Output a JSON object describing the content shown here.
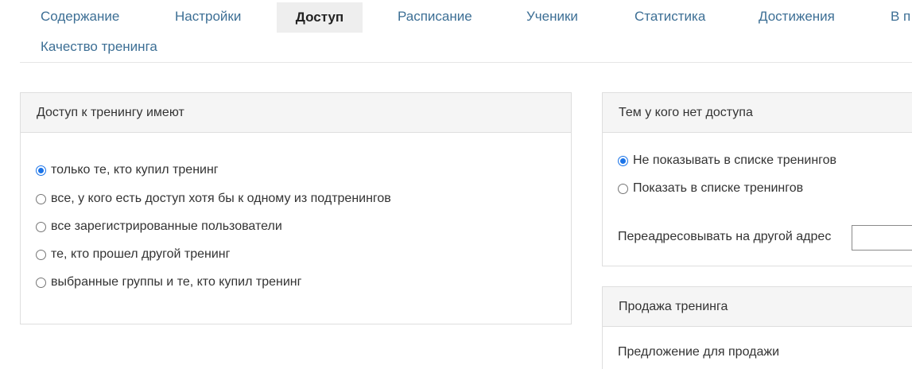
{
  "tabs": [
    {
      "label": "Содержание",
      "active": false
    },
    {
      "label": "Настройки",
      "active": false
    },
    {
      "label": "Доступ",
      "active": true
    },
    {
      "label": "Расписание",
      "active": false
    },
    {
      "label": "Ученики",
      "active": false
    },
    {
      "label": "Статистика",
      "active": false
    },
    {
      "label": "Достижения",
      "active": false
    },
    {
      "label": "В п",
      "active": false
    },
    {
      "label": "Качество тренинга",
      "active": false
    }
  ],
  "access_panel": {
    "title": "Доступ к тренингу имеют",
    "options": [
      {
        "label": "только те, кто купил тренинг",
        "checked": true
      },
      {
        "label": "все, у кого есть доступ хотя бы к одному из подтренингов",
        "checked": false
      },
      {
        "label": "все зарегистрированные пользователи",
        "checked": false
      },
      {
        "label": "те, кто прошел другой тренинг",
        "checked": false
      },
      {
        "label": "выбранные группы и те, кто купил тренинг",
        "checked": false
      }
    ]
  },
  "no_access_panel": {
    "title": "Тем у кого нет доступа",
    "options": [
      {
        "label": "Не показывать в списке тренингов",
        "checked": true
      },
      {
        "label": "Показать в списке тренингов",
        "checked": false
      }
    ],
    "redirect_label": "Переадресовывать на другой адрес",
    "redirect_value": ""
  },
  "sale_panel": {
    "title": "Продажа тренинга",
    "offer_label": "Предложение для продажи"
  },
  "colors": {
    "tab_link": "#3d6f95",
    "tab_active_bg": "#eeeeee",
    "panel_header_bg": "#f5f5f5",
    "panel_border": "#dedede",
    "radio_checked": "#1a73e8"
  }
}
